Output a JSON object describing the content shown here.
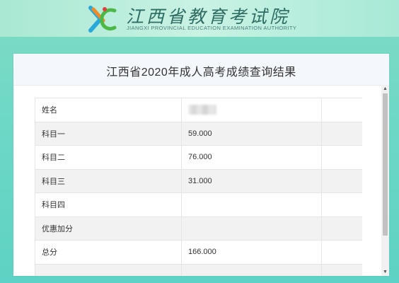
{
  "header": {
    "brand_cn": "江西省教育考试院",
    "brand_en": "JIANGXI PROVINCIAL EDUCATION EXAMINATION AUTHORITY",
    "logo_icon": "jx-logo-icon"
  },
  "panel": {
    "title": "江西省2020年成人高考成绩查询结果"
  },
  "results": {
    "rows": [
      {
        "label": "姓名",
        "value": ""
      },
      {
        "label": "科目一",
        "value": "59.000"
      },
      {
        "label": "科目二",
        "value": "76.000"
      },
      {
        "label": "科目三",
        "value": "31.000"
      },
      {
        "label": "科目四",
        "value": ""
      },
      {
        "label": "优惠加分",
        "value": ""
      },
      {
        "label": "总分",
        "value": "166.000"
      },
      {
        "label": "",
        "value": ""
      }
    ]
  },
  "scrollbar": {
    "up_icon": "scroll-up-arrow-icon",
    "down_icon": "scroll-down-arrow-icon"
  },
  "colors": {
    "background": "#6fd8c6",
    "header": "#c9f2e4",
    "title_bar": "#f4f8fc",
    "row_alt": "#f2f2f2"
  }
}
